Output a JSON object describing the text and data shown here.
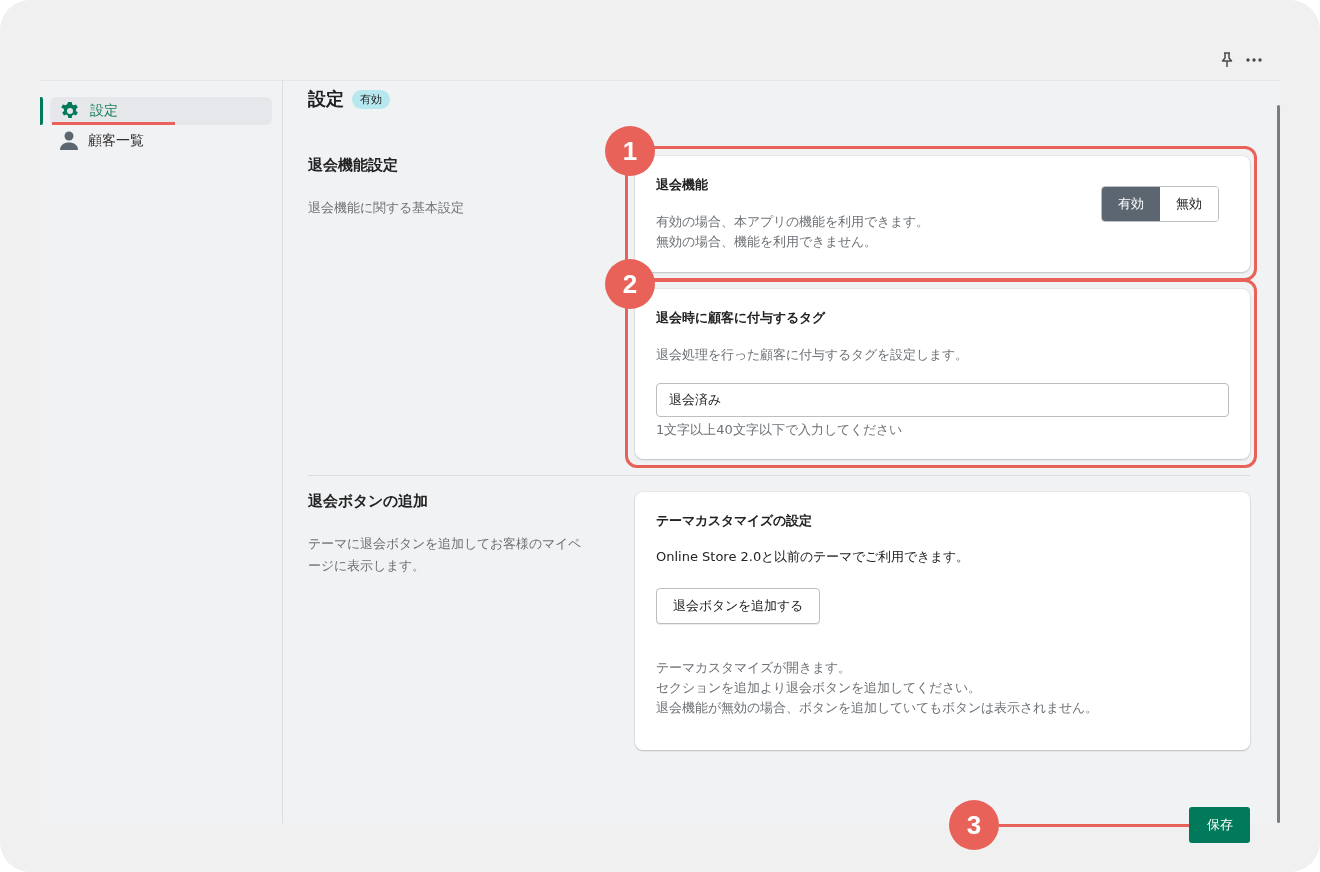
{
  "sidebar": {
    "items": [
      {
        "label": "設定",
        "kind": "gear",
        "selected": true,
        "underlined": true
      },
      {
        "label": "顧客一覧",
        "kind": "person",
        "selected": false,
        "underlined": false
      }
    ]
  },
  "page": {
    "title": "設定",
    "badge": "有効"
  },
  "sections": [
    {
      "title": "退会機能設定",
      "description": "退会機能に関する基本設定",
      "cards": [
        {
          "kind": "toggle",
          "callout": "1",
          "title": "退会機能",
          "description": [
            "有効の場合、本アプリの機能を利用できます。",
            "無効の場合、機能を利用できません。"
          ],
          "options": [
            {
              "label": "有効",
              "selected": true
            },
            {
              "label": "無効",
              "selected": false
            }
          ]
        },
        {
          "kind": "text_field",
          "callout": "2",
          "title": "退会時に顧客に付与するタグ",
          "description": [
            "退会処理を行った顧客に付与するタグを設定します。"
          ],
          "value": "退会済み",
          "help": "1文字以上40文字以下で入力してください"
        }
      ]
    },
    {
      "title": "退会ボタンの追加",
      "description": "テーマに退会ボタンを追加してお客様のマイページに表示します。",
      "cards": [
        {
          "kind": "action",
          "title": "テーマカスタマイズの設定",
          "text": "Online Store 2.0と以前のテーマでご利用できます。",
          "button": "退会ボタンを追加する",
          "notes": [
            "テーマカスタマイズが開きます。",
            "セクションを追加より退会ボタンを追加してください。",
            "退会機能が無効の場合、ボタンを追加していてもボタンは表示されません。"
          ]
        }
      ]
    }
  ],
  "save_button": {
    "label": "保存",
    "callout": "3"
  }
}
